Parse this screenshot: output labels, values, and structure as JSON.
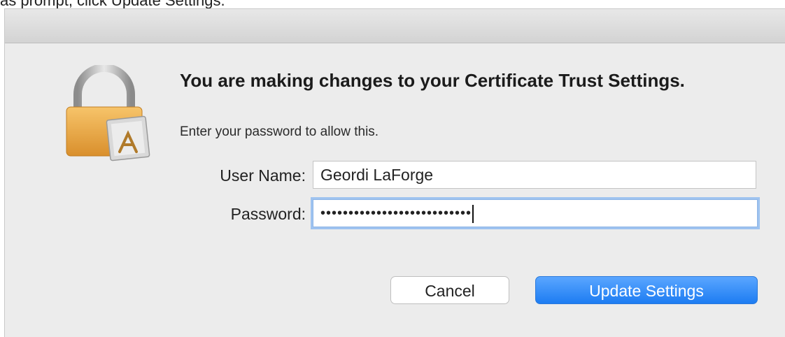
{
  "top_strip_text": "as prompt, click Update Settings.",
  "dialog": {
    "title": "You are making changes to your Certificate Trust Settings.",
    "subtitle": "Enter your password to allow this.",
    "username_label": "User Name:",
    "username_value": "Geordi LaForge",
    "password_label": "Password:",
    "password_value": "•••••••••••••••••••••••••••",
    "cancel_label": "Cancel",
    "update_label": "Update Settings",
    "icon": "lock-icon"
  },
  "colors": {
    "dialog_bg": "#ececec",
    "accent_blue": "#1d7cf2",
    "lock_gold": "#e9a94a"
  }
}
